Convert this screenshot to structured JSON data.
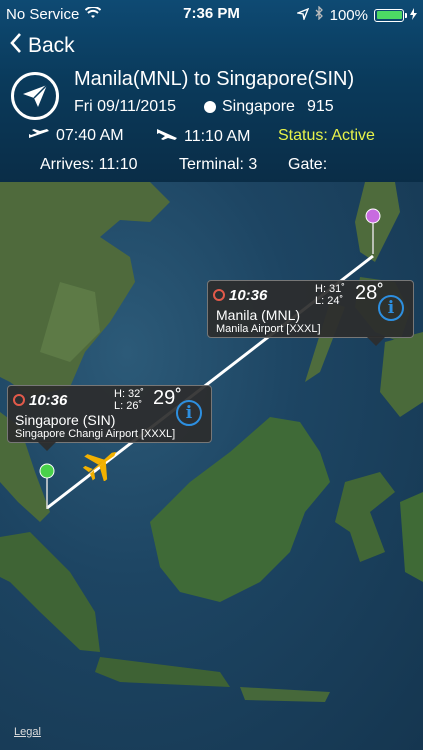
{
  "status_bar": {
    "carrier": "No Service",
    "time": "7:36 PM",
    "battery": "100%"
  },
  "nav": {
    "back_label": "Back"
  },
  "flight": {
    "route": "Manila(MNL) to Singapore(SIN)",
    "date": "Fri 09/11/2015",
    "airline": "Singapore",
    "number": "915",
    "departure_time": "07:40 AM",
    "arrival_time": "11:10 AM",
    "status": "Status: Active",
    "arrives": "Arrives: 11:10",
    "terminal": "Terminal: 3",
    "gate": "Gate:"
  },
  "map": {
    "callouts": [
      {
        "time": "10:36",
        "high": "H: 31˚",
        "low": "L: 24˚",
        "temp": "28˚",
        "city": "Manila (MNL)",
        "airport": "Manila Airport [XXXL]"
      },
      {
        "time": "10:36",
        "high": "H: 32˚",
        "low": "L: 26˚",
        "temp": "29˚",
        "city": "Singapore (SIN)",
        "airport": "Singapore Changi Airport [XXXL]"
      }
    ],
    "legal": "Legal"
  },
  "colors": {
    "status_active": "#e7f34a",
    "battery": "#4cd964",
    "origin_pin": "#c86be0",
    "destination_pin": "#49d14a",
    "plane": "#f2b100",
    "info_button": "#2d8fe0"
  }
}
